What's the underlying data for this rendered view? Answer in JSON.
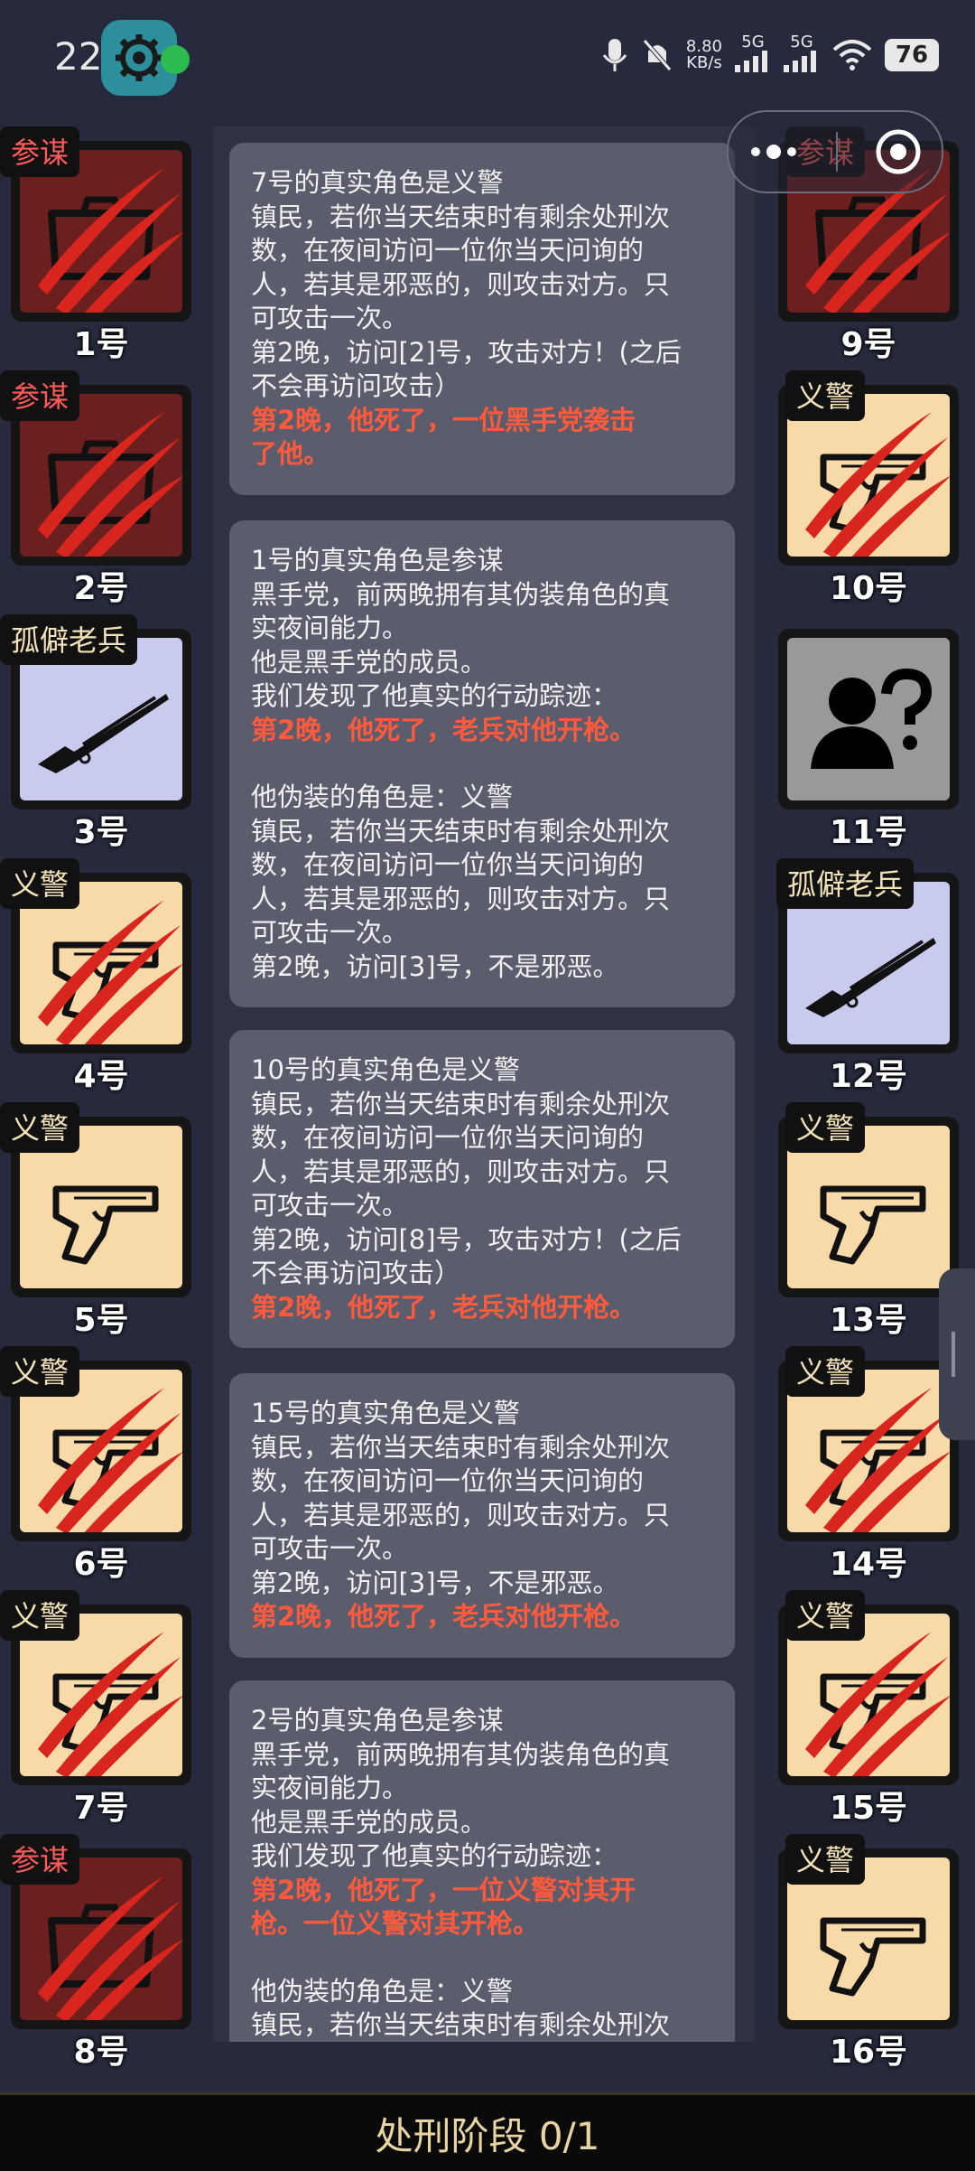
{
  "status_bar": {
    "time": "22:19",
    "net_speed_value": "8.80",
    "net_speed_unit": "KB/s",
    "signal1_label": "5G",
    "signal2_label": "5G",
    "battery": "76"
  },
  "players_left": [
    {
      "role": "参谋",
      "seat": "1号"
    },
    {
      "role": "参谋",
      "seat": "2号"
    },
    {
      "role": "孤僻老兵",
      "seat": "3号"
    },
    {
      "role": "义警",
      "seat": "4号"
    },
    {
      "role": "义警",
      "seat": "5号"
    },
    {
      "role": "义警",
      "seat": "6号"
    },
    {
      "role": "义警",
      "seat": "7号"
    },
    {
      "role": "参谋",
      "seat": "8号"
    }
  ],
  "players_right": [
    {
      "role": "参谋",
      "seat": "9号"
    },
    {
      "role": "义警",
      "seat": "10号"
    },
    {
      "role": "",
      "seat": "11号"
    },
    {
      "role": "孤僻老兵",
      "seat": "12号"
    },
    {
      "role": "义警",
      "seat": "13号"
    },
    {
      "role": "义警",
      "seat": "14号"
    },
    {
      "role": "义警",
      "seat": "15号"
    },
    {
      "role": "义警",
      "seat": "16号"
    }
  ],
  "log": {
    "card1": {
      "l1": "7号的真实角色是义警",
      "l2": "镇民，若你当天结束时有剩余处刑次",
      "l3": "数，在夜间访问一位你当天问询的",
      "l4": "人，若其是邪恶的，则攻击对方。只",
      "l5": "可攻击一次。",
      "l6": "第2晚，访问[2]号，攻击对方！(之后",
      "l7": "不会再访问攻击）",
      "a1": "第2晚，他死了，一位黑手党袭击",
      "a2": "了他。"
    },
    "card2": {
      "l1": "1号的真实角色是参谋",
      "l2": "黑手党，前两晚拥有其伪装角色的真",
      "l3": "实夜间能力。",
      "l4": "他是黑手党的成员。",
      "l5": "我们发现了他真实的行动踪迹：",
      "a1": "第2晚，他死了，老兵对他开枪。",
      "l6": "他伪装的角色是：义警",
      "l7": "镇民，若你当天结束时有剩余处刑次",
      "l8": "数，在夜间访问一位你当天问询的",
      "l9": "人，若其是邪恶的，则攻击对方。只",
      "l10": "可攻击一次。",
      "l11": "第2晚，访问[3]号，不是邪恶。"
    },
    "card3": {
      "l1": "10号的真实角色是义警",
      "l2": "镇民，若你当天结束时有剩余处刑次",
      "l3": "数，在夜间访问一位你当天问询的",
      "l4": "人，若其是邪恶的，则攻击对方。只",
      "l5": "可攻击一次。",
      "l6": "第2晚，访问[8]号，攻击对方！(之后",
      "l7": "不会再访问攻击）",
      "a1": "第2晚，他死了，老兵对他开枪。"
    },
    "card4": {
      "l1": "15号的真实角色是义警",
      "l2": "镇民，若你当天结束时有剩余处刑次",
      "l3": "数，在夜间访问一位你当天问询的",
      "l4": "人，若其是邪恶的，则攻击对方。只",
      "l5": "可攻击一次。",
      "l6": "第2晚，访问[3]号，不是邪恶。",
      "a1": "第2晚，他死了，老兵对他开枪。"
    },
    "card5": {
      "l1": "2号的真实角色是参谋",
      "l2": "黑手党，前两晚拥有其伪装角色的真",
      "l3": "实夜间能力。",
      "l4": "他是黑手党的成员。",
      "l5": "我们发现了他真实的行动踪迹：",
      "a1": "第2晚，他死了，一位义警对其开",
      "a2": "枪。一位义警对其开枪。",
      "l6": "他伪装的角色是：义警",
      "l7": "镇民，若你当天结束时有剩余处刑次"
    }
  },
  "bottom_bar": {
    "label": "处刑阶段 0/1"
  },
  "colors": {
    "background": "#262a3c",
    "card": "#5b5d6d",
    "alert": "#ff5a3c",
    "tile_red": "#6b1f1f",
    "tile_cream": "#f8d9a8",
    "tile_lavender": "#c9cbee",
    "bottom_text": "#e9d5a4"
  }
}
